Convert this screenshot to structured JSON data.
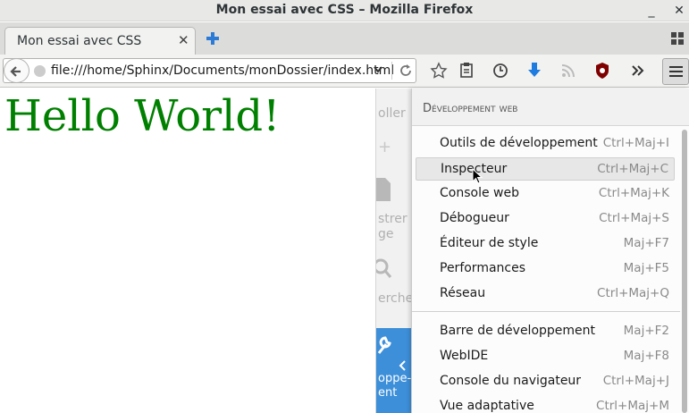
{
  "window": {
    "title": "Mon essai avec CSS – Mozilla Firefox",
    "minimize": "_",
    "close": "✕"
  },
  "tab": {
    "label": "Mon essai avec CSS",
    "close": "✕"
  },
  "url": {
    "value": "file:///home/Sphinx/Documents/monDossier/index.html"
  },
  "page": {
    "heading": "Hello World!"
  },
  "background_panel": {
    "items": [
      "oller",
      "+",
      "strer l",
      "ge",
      "ercher",
      "oppe-",
      "ent"
    ]
  },
  "dev_menu": {
    "title": "Développement web",
    "items": [
      {
        "label": "Outils de développement",
        "shortcut": "Ctrl+Maj+I"
      },
      {
        "label": "Inspecteur",
        "shortcut": "Ctrl+Maj+C"
      },
      {
        "label": "Console web",
        "shortcut": "Ctrl+Maj+K"
      },
      {
        "label": "Débogueur",
        "shortcut": "Ctrl+Maj+S"
      },
      {
        "label": "Éditeur de style",
        "shortcut": "Maj+F7"
      },
      {
        "label": "Performances",
        "shortcut": "Maj+F5"
      },
      {
        "label": "Réseau",
        "shortcut": "Ctrl+Maj+Q"
      },
      {
        "label": "Barre de développement",
        "shortcut": "Maj+F2"
      },
      {
        "label": "WebIDE",
        "shortcut": "Maj+F8"
      },
      {
        "label": "Console du navigateur",
        "shortcut": "Ctrl+Maj+J"
      },
      {
        "label": "Vue adaptative",
        "shortcut": "Ctrl+Maj+M"
      }
    ]
  },
  "colors": {
    "heading": "#008000",
    "accent_blue": "#3d8fd9"
  }
}
